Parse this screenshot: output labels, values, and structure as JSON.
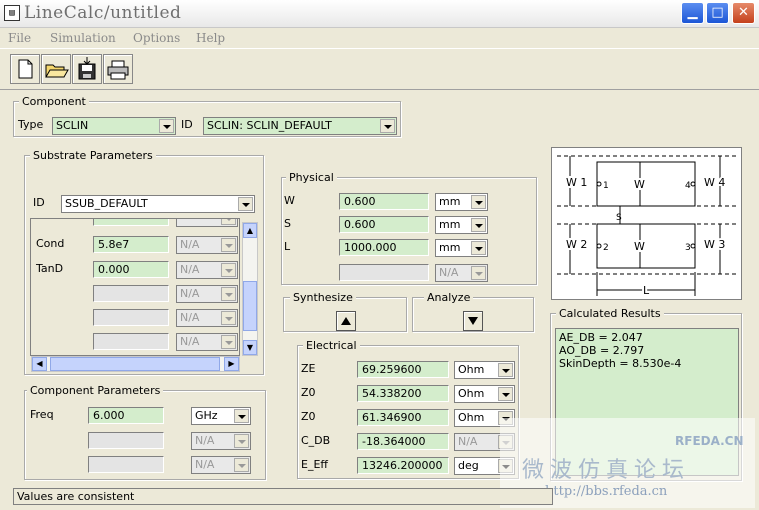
{
  "window": {
    "title": "LineCalc/untitled",
    "icon": "app-icon"
  },
  "menu": [
    "File",
    "Simulation",
    "Options",
    "Help"
  ],
  "toolbar": {
    "new_icon": "new-file-icon",
    "open_icon": "open-folder-icon",
    "save_icon": "save-icon",
    "print_icon": "print-icon"
  },
  "component": {
    "legend": "Component",
    "type_label": "Type",
    "type_value": "SCLIN",
    "id_label": "ID",
    "id_value": "SCLIN: SCLIN_DEFAULT"
  },
  "substrate": {
    "legend": "Substrate Parameters",
    "id_label": "ID",
    "id_value": "SSUB_DEFAULT",
    "rows": [
      {
        "label": "Cond",
        "value": "5.8e7",
        "unit": "N/A"
      },
      {
        "label": "TanD",
        "value": "0.000",
        "unit": "N/A"
      },
      {
        "label": "",
        "value": "",
        "unit": "N/A"
      },
      {
        "label": "",
        "value": "",
        "unit": "N/A"
      },
      {
        "label": "",
        "value": "",
        "unit": "N/A"
      }
    ]
  },
  "physical": {
    "legend": "Physical",
    "rows": [
      {
        "label": "W",
        "value": "0.600",
        "unit": "mm"
      },
      {
        "label": "S",
        "value": "0.600",
        "unit": "mm"
      },
      {
        "label": "L",
        "value": "1000.000",
        "unit": "mm"
      },
      {
        "label": "",
        "value": "",
        "unit": "N/A"
      }
    ]
  },
  "synthesize": {
    "label": "Synthesize"
  },
  "analyze": {
    "label": "Analyze"
  },
  "electrical": {
    "legend": "Electrical",
    "rows": [
      {
        "label": "ZE",
        "value": "69.259600",
        "unit": "Ohm"
      },
      {
        "label": "Z0",
        "value": "54.338200",
        "unit": "Ohm"
      },
      {
        "label": "Z0",
        "value": "61.346900",
        "unit": "Ohm"
      },
      {
        "label": "C_DB",
        "value": "-18.364000",
        "unit": "N/A"
      },
      {
        "label": "E_Eff",
        "value": "13246.200000",
        "unit": "deg"
      }
    ]
  },
  "component_params": {
    "legend": "Component Parameters",
    "freq_label": "Freq",
    "freq_value": "6.000",
    "freq_unit": "GHz",
    "extra_units": [
      "N/A",
      "N/A"
    ]
  },
  "diagram": {
    "w1": "W 1",
    "w2": "W 2",
    "w3": "W 3",
    "w4": "W 4",
    "w": "W",
    "s": "S",
    "l": "L",
    "p1": "1",
    "p2": "2",
    "p3": "3",
    "p4": "4"
  },
  "results": {
    "legend": "Calculated Results",
    "lines": [
      "AE_DB = 2.047",
      "AO_DB = 2.797",
      "SkinDepth = 8.530e-4"
    ]
  },
  "status": "Values are consistent",
  "watermark": {
    "line1": "RFEDA.CN",
    "line2": "微波仿真论坛",
    "line3": "http://bbs.rfeda.cn"
  }
}
